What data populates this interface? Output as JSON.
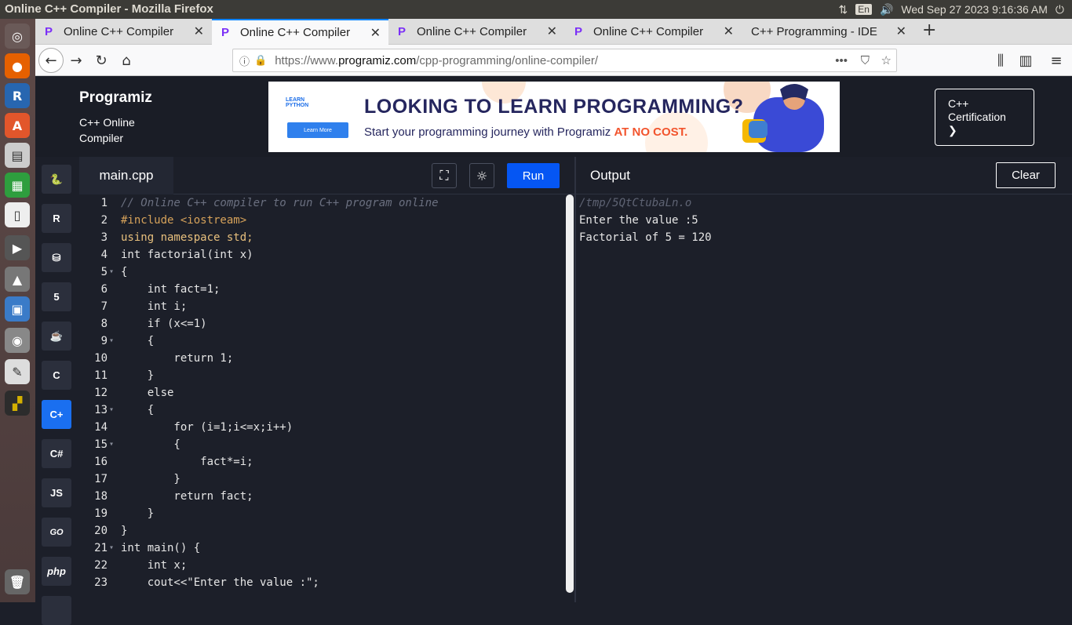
{
  "os": {
    "window_title": "Online C++ Compiler - Mozilla Firefox",
    "lang_indicator": "En",
    "clock": "Wed Sep 27 2023  9:16:36 AM"
  },
  "browser": {
    "tabs": [
      {
        "label": "Online C++ Compiler",
        "active": false
      },
      {
        "label": "Online C++ Compiler",
        "active": true
      },
      {
        "label": "Online C++ Compiler",
        "active": false
      },
      {
        "label": "Online C++ Compiler",
        "active": false
      },
      {
        "label": "C++ Programming - IDE",
        "active": false
      }
    ],
    "url_prefix": "https://www.",
    "url_domain": "programiz.com",
    "url_path": "/cpp-programming/online-compiler/"
  },
  "site": {
    "logo": "Programiz",
    "subtitle": "C++ Online Compiler",
    "banner": {
      "badge": "LEARN PYTHON",
      "button": "Learn More",
      "headline": "LOOKING TO LEARN PROGRAMMING?",
      "tagline": "Start your programming journey with Programiz ",
      "tagline_highlight": "AT NO COST."
    },
    "cert_label": "C++ Certification",
    "cert_arrow": "❯",
    "languages": [
      "Python",
      "R",
      "SQL",
      "HTML",
      "Java",
      "C",
      "C++",
      "C#",
      "JS",
      "GO",
      "php"
    ]
  },
  "editor": {
    "filename": "main.cpp",
    "run_label": "Run",
    "lines": [
      "// Online C++ compiler to run C++ program online",
      "#include <iostream>",
      "using namespace std;",
      "int factorial(int x)",
      "{",
      "    int fact=1;",
      "    int i;",
      "    if (x<=1)",
      "    {",
      "        return 1;",
      "    }",
      "    else",
      "    {",
      "        for (i=1;i<=x;i++)",
      "        {",
      "            fact*=i;",
      "        }",
      "        return fact;",
      "    }",
      "}",
      "int main() {",
      "    int x;",
      "    cout<<\"Enter the value :\";"
    ]
  },
  "output": {
    "title": "Output",
    "clear_label": "Clear",
    "lines": [
      "/tmp/5QtCtubaLn.o",
      "Enter the value :5",
      "Factorial of 5 = 120"
    ]
  }
}
